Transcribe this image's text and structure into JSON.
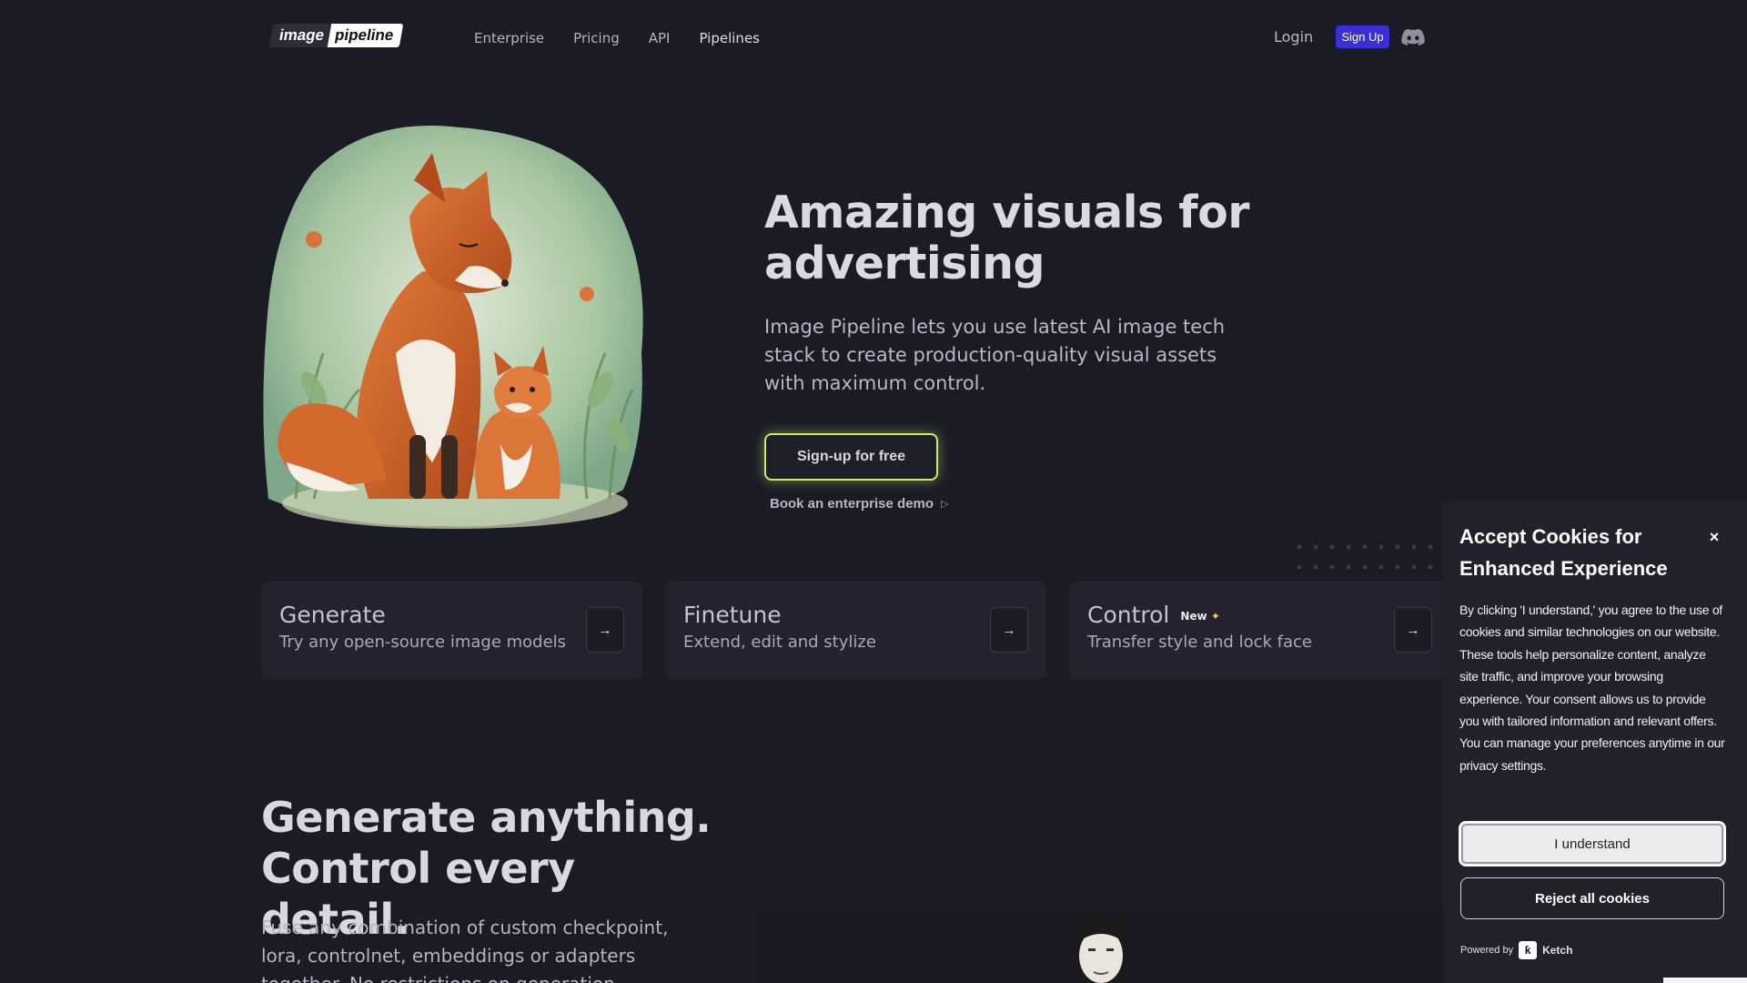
{
  "nav": {
    "logo_left": "image",
    "logo_right": "pipeline",
    "links": [
      "Enterprise",
      "Pricing",
      "API",
      "Pipelines"
    ],
    "login": "Login",
    "signup": "Sign Up",
    "discord_icon": "discord-icon"
  },
  "hero": {
    "title": "Amazing visuals for advertising",
    "subtitle": "Image Pipeline lets you use latest AI image tech stack to create production-quality visual assets with maximum control.",
    "cta": "Sign-up for free",
    "demo_link": "Book an enterprise demo",
    "demo_icon": "▷",
    "accent": "#c6ee6a"
  },
  "cards": [
    {
      "title": "Generate",
      "desc": "Try any open-source image models",
      "badge": "",
      "arrow": "→"
    },
    {
      "title": "Finetune",
      "desc": "Extend, edit and stylize",
      "badge": "",
      "arrow": "→"
    },
    {
      "title": "Control",
      "desc": "Transfer style and lock face",
      "badge": "New",
      "arrow": "→"
    }
  ],
  "section2": {
    "title_line1": "Generate anything.",
    "title_line2": "Control every detail.",
    "subtitle": "Fuse any combination of custom checkpoint, lora, controlnet, embeddings or adapters together. No restrictions on generation."
  },
  "cookie": {
    "title": "Accept Cookies for Enhanced Experience",
    "close": "×",
    "body": "By clicking 'I understand,' you agree to the use of cookies and similar technologies on our website. These tools help personalize content, analyze site traffic, and improve your browsing experience. Your consent allows us to provide you with tailored information and relevant offers. You can manage your preferences anytime in our privacy settings.",
    "accept": "I understand",
    "reject": "Reject all cookies",
    "powered_by": "Powered by",
    "brand": "Ketch"
  },
  "colors": {
    "background": "#1b1b26",
    "signup_button": "#3a2fd6",
    "card": "#23232f"
  }
}
